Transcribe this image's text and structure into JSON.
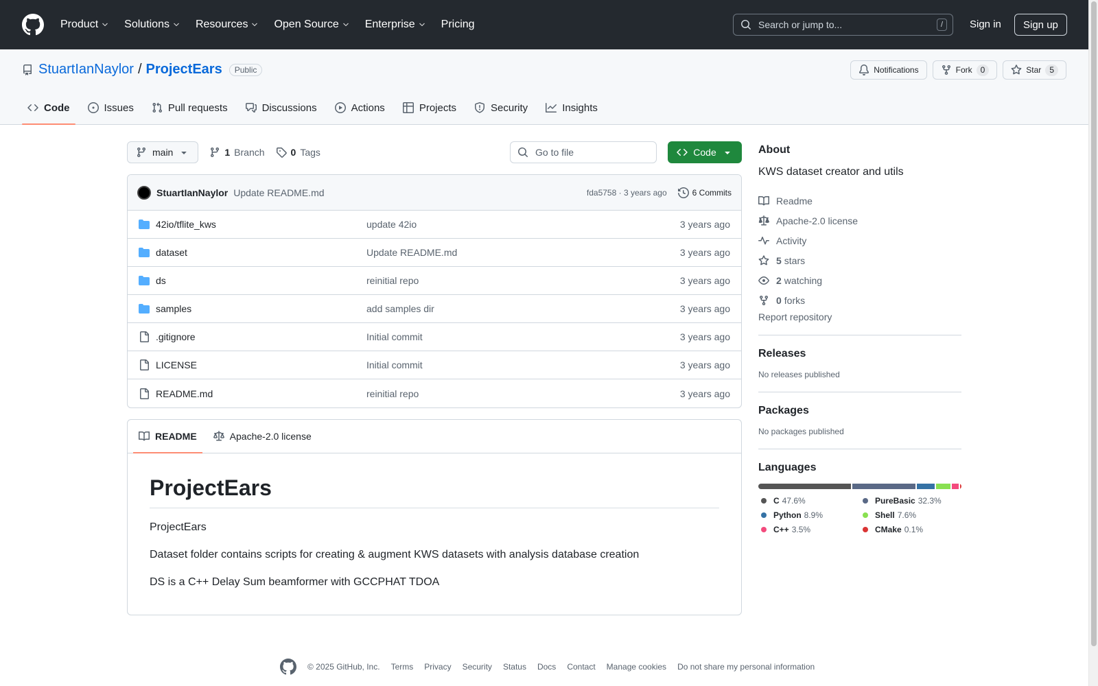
{
  "header": {
    "nav": [
      "Product",
      "Solutions",
      "Resources",
      "Open Source",
      "Enterprise",
      "Pricing"
    ],
    "search_placeholder": "Search or jump to...",
    "search_shortcut": "/",
    "signin": "Sign in",
    "signup": "Sign up"
  },
  "repo": {
    "owner": "StuartIanNaylor",
    "separator": "/",
    "name": "ProjectEars",
    "visibility": "Public",
    "notifications_label": "Notifications",
    "fork_label": "Fork",
    "fork_count": "0",
    "star_label": "Star",
    "star_count": "5"
  },
  "tabs": [
    "Code",
    "Issues",
    "Pull requests",
    "Discussions",
    "Actions",
    "Projects",
    "Security",
    "Insights"
  ],
  "toolbar": {
    "branch": "main",
    "branch_count": "1",
    "branch_label": "Branch",
    "tag_count": "0",
    "tag_label": "Tags",
    "goto_placeholder": "Go to file",
    "code_label": "Code"
  },
  "commit": {
    "author": "StuartIanNaylor",
    "message": "Update README.md",
    "hash_time": "fda5758 · 3 years ago",
    "commits_label": "6 Commits"
  },
  "files": [
    {
      "name": "42io/tflite_kws",
      "type": "folder",
      "message": "update 42io",
      "time": "3 years ago"
    },
    {
      "name": "dataset",
      "type": "folder",
      "message": "Update README.md",
      "time": "3 years ago"
    },
    {
      "name": "ds",
      "type": "folder",
      "message": "reinitial repo",
      "time": "3 years ago"
    },
    {
      "name": "samples",
      "type": "folder",
      "message": "add samples dir",
      "time": "3 years ago"
    },
    {
      "name": ".gitignore",
      "type": "file",
      "message": "Initial commit",
      "time": "3 years ago"
    },
    {
      "name": "LICENSE",
      "type": "file",
      "message": "Initial commit",
      "time": "3 years ago"
    },
    {
      "name": "README.md",
      "type": "file",
      "message": "reinitial repo",
      "time": "3 years ago"
    }
  ],
  "readme": {
    "tab_readme": "README",
    "tab_license": "Apache-2.0 license",
    "title": "ProjectEars",
    "paragraphs": [
      "ProjectEars",
      "Dataset folder contains scripts for creating & augment KWS datasets with analysis database creation",
      "DS is a C++ Delay Sum beamformer with GCCPHAT TDOA"
    ]
  },
  "about": {
    "heading": "About",
    "description": "KWS dataset creator and utils",
    "readme": "Readme",
    "license": "Apache-2.0 license",
    "activity": "Activity",
    "stars_count": "5",
    "stars_label": "stars",
    "watching_count": "2",
    "watching_label": "watching",
    "forks_count": "0",
    "forks_label": "forks",
    "report": "Report repository"
  },
  "releases": {
    "heading": "Releases",
    "text": "No releases published"
  },
  "packages": {
    "heading": "Packages",
    "text": "No packages published"
  },
  "languages": {
    "heading": "Languages",
    "items": [
      {
        "name": "C",
        "pct": "47.6%",
        "value": 47.6,
        "color": "#555555"
      },
      {
        "name": "PureBasic",
        "pct": "32.3%",
        "value": 32.3,
        "color": "#5a6986"
      },
      {
        "name": "Python",
        "pct": "8.9%",
        "value": 8.9,
        "color": "#3572A5"
      },
      {
        "name": "Shell",
        "pct": "7.6%",
        "value": 7.6,
        "color": "#89e051"
      },
      {
        "name": "C++",
        "pct": "3.5%",
        "value": 3.5,
        "color": "#f34b7d"
      },
      {
        "name": "CMake",
        "pct": "0.1%",
        "value": 0.1,
        "color": "#DA3434"
      }
    ]
  },
  "footer": [
    "© 2025 GitHub, Inc.",
    "Terms",
    "Privacy",
    "Security",
    "Status",
    "Docs",
    "Contact",
    "Manage cookies",
    "Do not share my personal information"
  ]
}
